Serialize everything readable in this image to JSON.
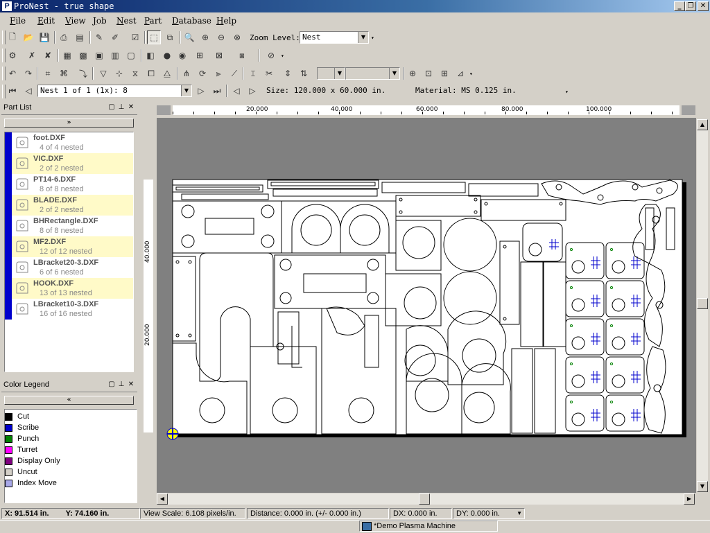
{
  "window": {
    "title": "ProNest - true shape",
    "app_icon": "P"
  },
  "menu": [
    "File",
    "Edit",
    "View",
    "Job",
    "Nest",
    "Part",
    "Database",
    "Help"
  ],
  "toolbar1": {
    "zoom_label": "Zoom Level:",
    "zoom_value": "Nest"
  },
  "toolbar4": {
    "nest_selector": "Nest 1 of 1 (1x): 8",
    "size": "Size: 120.000 x 60.000 in.",
    "material": "Material: MS 0.125 in."
  },
  "part_list": {
    "title": "Part List",
    "items": [
      {
        "name": "foot.DXF",
        "count": "4 of 4 nested",
        "highlight": false,
        "icon": "foot-part-icon"
      },
      {
        "name": "VIC.DXF",
        "count": "2 of 2 nested",
        "highlight": true,
        "icon": "vic-part-icon"
      },
      {
        "name": "PT14-6.DXF",
        "count": "8 of 8 nested",
        "highlight": false,
        "icon": "pt14-part-icon"
      },
      {
        "name": "BLADE.DXF",
        "count": "2 of 2 nested",
        "highlight": true,
        "icon": "blade-part-icon"
      },
      {
        "name": "BHRectangle.DXF",
        "count": "8 of 8 nested",
        "highlight": false,
        "icon": "rectangle-part-icon"
      },
      {
        "name": "MF2.DXF",
        "count": "12 of 12 nested",
        "highlight": true,
        "icon": "mf2-part-icon"
      },
      {
        "name": "LBracket20-3.DXF",
        "count": "6 of 6 nested",
        "highlight": false,
        "icon": "lbracket-part-icon"
      },
      {
        "name": "HOOK.DXF",
        "count": "13 of 13 nested",
        "highlight": true,
        "icon": "hook-part-icon"
      },
      {
        "name": "LBracket10-3.DXF",
        "count": "16 of 16 nested",
        "highlight": false,
        "icon": "lbracket-part-icon"
      }
    ]
  },
  "color_legend": {
    "title": "Color Legend",
    "items": [
      {
        "label": "Cut",
        "color": "#000000"
      },
      {
        "label": "Scribe",
        "color": "#0000cc"
      },
      {
        "label": "Punch",
        "color": "#008000"
      },
      {
        "label": "Turret",
        "color": "#ff00ff"
      },
      {
        "label": "Display Only",
        "color": "#800080"
      },
      {
        "label": "Uncut",
        "color": "#d4d0c8"
      },
      {
        "label": "Index Move",
        "color": "#a8a8e8"
      }
    ]
  },
  "ruler": {
    "h": [
      "20.000",
      "40.000",
      "60.000",
      "80.000",
      "100.000"
    ],
    "v": [
      "40.000",
      "20.000"
    ]
  },
  "status": {
    "x": "X: 91.514 in.",
    "y": "Y: 74.160 in.",
    "view_scale": "View Scale: 6.108 pixels/in.",
    "distance": "Distance: 0.000 in. (+/- 0.000 in.)",
    "dx": "DX: 0.000 in.",
    "dy": "DY: 0.000 in.",
    "machine": "*Demo Plasma Machine"
  }
}
